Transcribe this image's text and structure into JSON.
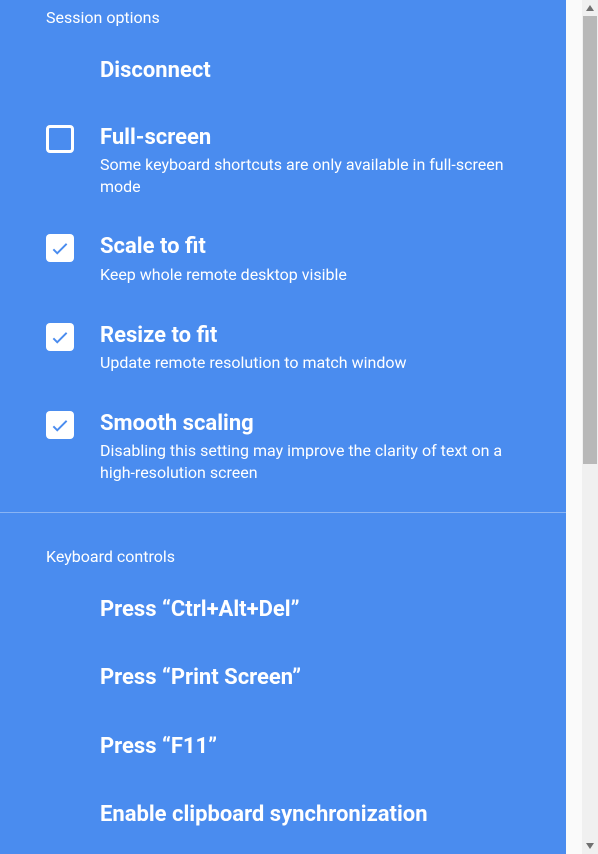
{
  "colors": {
    "panel_bg": "#4a8cef",
    "text": "#ffffff"
  },
  "sessionOptions": {
    "header": "Session options",
    "disconnect": {
      "title": "Disconnect"
    },
    "fullScreen": {
      "title": "Full-screen",
      "desc": "Some keyboard shortcuts are only available in full-screen mode",
      "checked": false
    },
    "scaleToFit": {
      "title": "Scale to fit",
      "desc": "Keep whole remote desktop visible",
      "checked": true
    },
    "resizeToFit": {
      "title": "Resize to fit",
      "desc": "Update remote resolution to match window",
      "checked": true
    },
    "smoothScaling": {
      "title": "Smooth scaling",
      "desc": "Disabling this setting may improve the clarity of text on a high-resolution screen",
      "checked": true
    }
  },
  "keyboardControls": {
    "header": "Keyboard controls",
    "ctrlAltDel": {
      "title": "Press “Ctrl+Alt+Del”"
    },
    "printScreen": {
      "title": "Press “Print Screen”"
    },
    "f11": {
      "title": "Press “F11”"
    },
    "clipboardSync": {
      "title": "Enable clipboard synchronization"
    }
  }
}
